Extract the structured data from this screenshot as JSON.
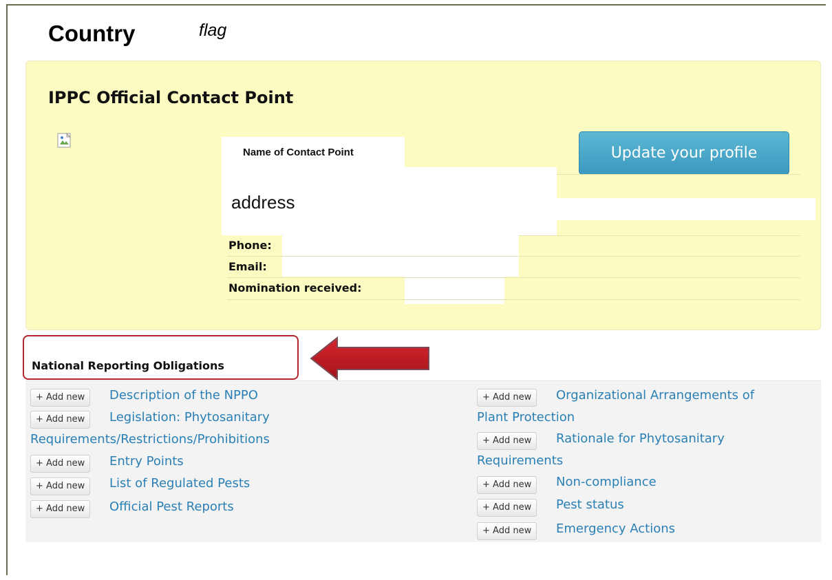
{
  "header": {
    "country_label": "Country",
    "flag_label": "flag"
  },
  "contact": {
    "title": "IPPC Official Contact Point",
    "update_button_label": "Update your profile",
    "name_label": "Name of Contact Point",
    "address_label": "address",
    "phone_label": "Phone:",
    "email_label": "Email:",
    "nomination_label": "Nomination received:"
  },
  "obligations": {
    "title": "National Reporting Obligations",
    "add_label": "+ Add new",
    "left_items": [
      {
        "line1": "Description of the NPPO",
        "line2": ""
      },
      {
        "line1": "Legislation: Phytosanitary",
        "line2": "Requirements/Restrictions/Prohibitions"
      },
      {
        "line1": "Entry Points",
        "line2": ""
      },
      {
        "line1": "List of Regulated Pests",
        "line2": ""
      },
      {
        "line1": "Official Pest Reports",
        "line2": ""
      }
    ],
    "right_items": [
      {
        "line1": "Organizational Arrangements of",
        "line2": "Plant Protection"
      },
      {
        "line1": "Rationale for Phytosanitary",
        "line2": "Requirements"
      },
      {
        "line1": "Non-compliance",
        "line2": ""
      },
      {
        "line1": "Pest status",
        "line2": ""
      },
      {
        "line1": "Emergency Actions",
        "line2": ""
      }
    ]
  },
  "colors": {
    "panel_yellow": "#fbfbc2",
    "button_blue": "#4aa9cc",
    "link_blue": "#2a7fb5",
    "highlight_red": "#b3242c",
    "arrow_red": "#c0161f"
  }
}
